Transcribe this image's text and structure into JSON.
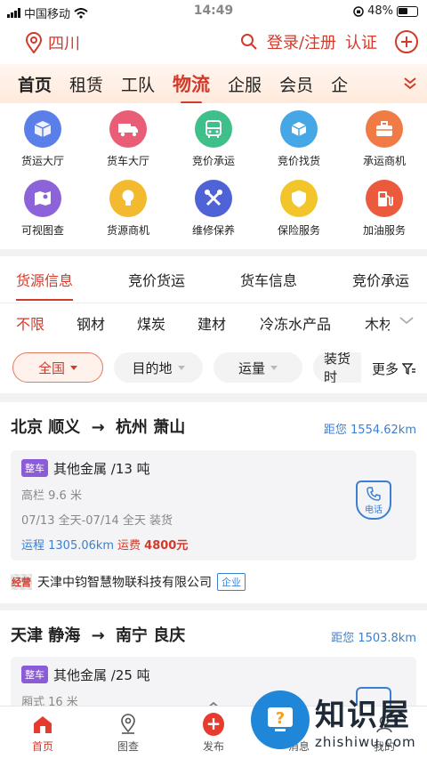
{
  "status_bar": {
    "carrier": "中国移动",
    "time": "14:49",
    "battery": "48%"
  },
  "header": {
    "location": "四川",
    "login": "登录/注册",
    "verify": "认证"
  },
  "main_tabs": [
    "首页",
    "租赁",
    "工队",
    "物流",
    "企服",
    "会员",
    "企"
  ],
  "main_tabs_active": "物流",
  "services": [
    {
      "label": "货运大厅",
      "icon": "box-icon",
      "color": "#5b7fe8"
    },
    {
      "label": "货车大厅",
      "icon": "truck-icon",
      "color": "#ea5d77"
    },
    {
      "label": "竞价承运",
      "icon": "bus-icon",
      "color": "#3fbf8a"
    },
    {
      "label": "竞价找货",
      "icon": "package-icon",
      "color": "#45a7e6"
    },
    {
      "label": "承运商机",
      "icon": "briefcase-icon",
      "color": "#f07b45"
    },
    {
      "label": "可视图查",
      "icon": "map-icon",
      "color": "#8c63d8"
    },
    {
      "label": "货源商机",
      "icon": "bulb-icon",
      "color": "#f3b92f"
    },
    {
      "label": "维修保养",
      "icon": "tools-icon",
      "color": "#4f63d6"
    },
    {
      "label": "保险服务",
      "icon": "shield-icon",
      "color": "#f2c62b"
    },
    {
      "label": "加油服务",
      "icon": "fuel-icon",
      "color": "#ec5a3d"
    }
  ],
  "sub_tabs": [
    "货源信息",
    "竞价货运",
    "货车信息",
    "竞价承运"
  ],
  "categories": [
    "不限",
    "钢材",
    "煤炭",
    "建材",
    "冷冻水产品",
    "木材"
  ],
  "filters": {
    "region": "全国",
    "destination": "目的地",
    "volume": "运量",
    "loading": "装货时",
    "more": "更多"
  },
  "listings": [
    {
      "from": "北京 顺义",
      "to": "杭州 萧山",
      "distance": "距您 1554.62km",
      "tag": "整车",
      "goods": "其他金属 /13 吨",
      "spec": "高栏 9.6 米",
      "time": "07/13 全天-07/14 全天 装货",
      "route_distance": "运程 1305.06km",
      "fee_label": "运费",
      "fee": "4800元",
      "phone_label": "电话",
      "stamp": "经营",
      "company": "天津中钧智慧物联科技有限公司",
      "company_type": "企业"
    },
    {
      "from": "天津 静海",
      "to": "南宁 良庆",
      "distance": "距您 1503.8km",
      "tag": "整车",
      "goods": "其他金属 /25 吨",
      "spec": "厢式 16 米"
    }
  ],
  "arrow": "→",
  "bottom_nav": [
    "首页",
    "图查",
    "发布",
    "消息",
    "我的"
  ],
  "watermark": {
    "title": "知识屋",
    "url": "zhishiwu.com"
  }
}
